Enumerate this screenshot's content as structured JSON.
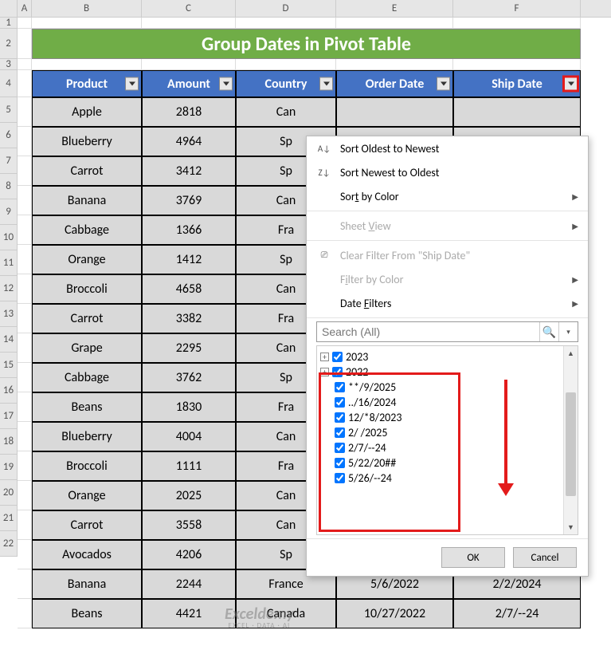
{
  "columns": [
    "A",
    "B",
    "C",
    "D",
    "E",
    "F"
  ],
  "title": "Group Dates in Pivot Table",
  "headers": {
    "product": "Product",
    "amount": "Amount",
    "country": "Country",
    "order_date": "Order Date",
    "ship_date": "Ship Date"
  },
  "rows": [
    {
      "n": "5",
      "product": "Apple",
      "amount": "2818",
      "country": "Can",
      "order": "",
      "ship": ""
    },
    {
      "n": "6",
      "product": "Blueberry",
      "amount": "4964",
      "country": "Sp",
      "order": "",
      "ship": ""
    },
    {
      "n": "7",
      "product": "Carrot",
      "amount": "3412",
      "country": "Sp",
      "order": "",
      "ship": ""
    },
    {
      "n": "8",
      "product": "Banana",
      "amount": "3769",
      "country": "Can",
      "order": "",
      "ship": ""
    },
    {
      "n": "9",
      "product": "Cabbage",
      "amount": "1366",
      "country": "Fra",
      "order": "",
      "ship": ""
    },
    {
      "n": "10",
      "product": "Orange",
      "amount": "1412",
      "country": "Sp",
      "order": "",
      "ship": ""
    },
    {
      "n": "11",
      "product": "Broccoli",
      "amount": "4658",
      "country": "Can",
      "order": "",
      "ship": ""
    },
    {
      "n": "12",
      "product": "Carrot",
      "amount": "3382",
      "country": "Fra",
      "order": "",
      "ship": ""
    },
    {
      "n": "13",
      "product": "Grape",
      "amount": "2295",
      "country": "Can",
      "order": "",
      "ship": ""
    },
    {
      "n": "14",
      "product": "Cabbage",
      "amount": "3762",
      "country": "Sp",
      "order": "",
      "ship": ""
    },
    {
      "n": "15",
      "product": "Beans",
      "amount": "1830",
      "country": "Fra",
      "order": "",
      "ship": ""
    },
    {
      "n": "16",
      "product": "Blueberry",
      "amount": "4004",
      "country": "Can",
      "order": "",
      "ship": ""
    },
    {
      "n": "17",
      "product": "Broccoli",
      "amount": "1111",
      "country": "Fra",
      "order": "",
      "ship": ""
    },
    {
      "n": "18",
      "product": "Orange",
      "amount": "2025",
      "country": "Can",
      "order": "",
      "ship": ""
    },
    {
      "n": "19",
      "product": "Carrot",
      "amount": "3558",
      "country": "Can",
      "order": "",
      "ship": ""
    },
    {
      "n": "20",
      "product": "Avocados",
      "amount": "4206",
      "country": "Sp",
      "order": "",
      "ship": ""
    },
    {
      "n": "21",
      "product": "Banana",
      "amount": "2244",
      "country": "France",
      "order": "5/6/2022",
      "ship": "2/2/2024"
    },
    {
      "n": "22",
      "product": "Beans",
      "amount": "4421",
      "country": "Canada",
      "order": "10/27/2022",
      "ship": "2/7/--24"
    }
  ],
  "row_headers_pre": [
    "1",
    "2",
    "3",
    "4"
  ],
  "dropdown": {
    "sort_oldest": "Sort Oldest to Newest",
    "sort_newest": "Sort Newest to Oldest",
    "sort_color": "Sort by Color",
    "sheet_view": "Sheet View",
    "clear_filter": "Clear Filter From \"Ship Date\"",
    "filter_color": "Filter by Color",
    "date_filters": "Date Filters",
    "search_placeholder": "Search (All)",
    "tree": [
      {
        "label": "2023",
        "expandable": true
      },
      {
        "label": "2022",
        "expandable": true
      },
      {
        "label": "**/9/2025",
        "expandable": false
      },
      {
        "label": "../16/2024",
        "expandable": false
      },
      {
        "label": "12/*8/2023",
        "expandable": false
      },
      {
        "label": "2/  /2025",
        "expandable": false
      },
      {
        "label": "2/7/--24",
        "expandable": false
      },
      {
        "label": "5/22/20##",
        "expandable": false
      },
      {
        "label": "5/26/--24",
        "expandable": false
      }
    ],
    "ok": "OK",
    "cancel": "Cancel"
  },
  "watermark": {
    "main": "Exceldemy",
    "sub": "EXCEL · DATA · AI"
  }
}
